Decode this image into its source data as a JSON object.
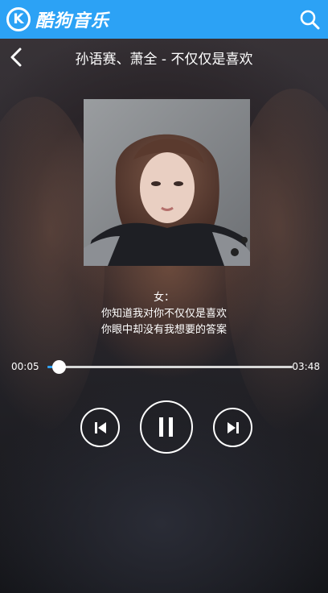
{
  "app": {
    "name": "酷狗音乐",
    "logo_letter": "K",
    "accent_color": "#2ca2f5"
  },
  "header": {
    "search_icon": "search-icon",
    "back_icon": "chevron-left-icon"
  },
  "song": {
    "title": "孙语赛、萧全 - 不仅仅是喜欢"
  },
  "lyrics": {
    "lines": [
      "女：",
      "你知道我对你不仅仅是喜欢",
      "你眼中却没有我想要的答案"
    ]
  },
  "player": {
    "current_time": "00:05",
    "total_time": "03:48",
    "progress": 0.045,
    "state": "playing",
    "prev_icon": "skip-previous-icon",
    "pause_icon": "pause-icon",
    "next_icon": "skip-next-icon"
  }
}
